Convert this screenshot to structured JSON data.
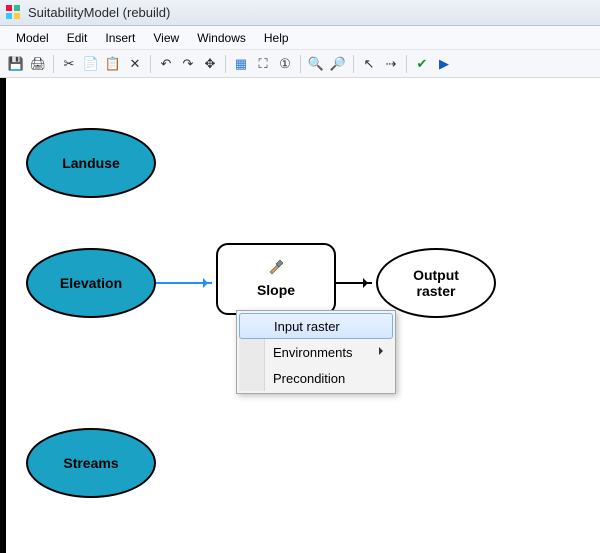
{
  "window": {
    "title": "SuitabilityModel (rebuild)"
  },
  "menu": {
    "items": [
      "Model",
      "Edit",
      "Insert",
      "View",
      "Windows",
      "Help"
    ]
  },
  "toolbar": {
    "save": "💾",
    "print": "🖨",
    "cut": "✂",
    "copy": "📄",
    "paste": "📋",
    "delete": "✕",
    "undo": "↶",
    "redo": "↷",
    "pan": "✥",
    "layout_grid": "▦",
    "fitwindow": "⛶",
    "zoom100": "①",
    "zoomin": "🔍",
    "zoomout": "🔎",
    "select": "↖",
    "addconnect": "⇢",
    "validate": "✔",
    "run": "▶"
  },
  "model": {
    "landuse": "Landuse",
    "elevation": "Elevation",
    "streams": "Streams",
    "slope_tool": "Slope",
    "output_raster_l1": "Output",
    "output_raster_l2": "raster"
  },
  "context_menu": {
    "input_raster": "Input raster",
    "environments": "Environments",
    "precondition": "Precondition"
  }
}
